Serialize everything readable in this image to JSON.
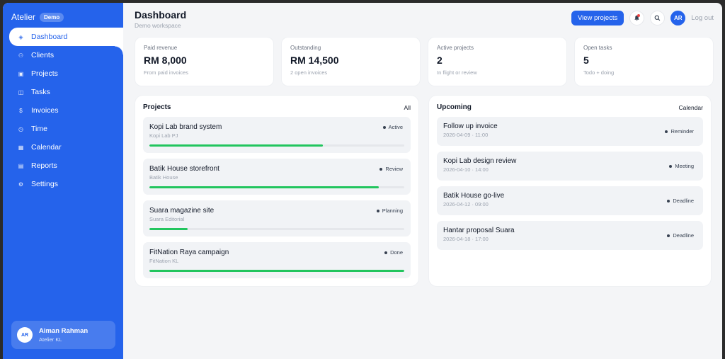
{
  "sidebar": {
    "brand": "Atelier",
    "badge": "Demo",
    "items": [
      {
        "label": "Dashboard",
        "icon": "diamond-icon",
        "glyph": "◈",
        "active": true
      },
      {
        "label": "Clients",
        "icon": "users-icon",
        "glyph": "⚇"
      },
      {
        "label": "Projects",
        "icon": "folder-icon",
        "glyph": "▣"
      },
      {
        "label": "Tasks",
        "icon": "chart-icon",
        "glyph": "◫"
      },
      {
        "label": "Invoices",
        "icon": "dollar-icon",
        "glyph": "$"
      },
      {
        "label": "Time",
        "icon": "clock-icon",
        "glyph": "◷"
      },
      {
        "label": "Calendar",
        "icon": "calendar-icon",
        "glyph": "▦"
      },
      {
        "label": "Reports",
        "icon": "reports-icon",
        "glyph": "▤"
      },
      {
        "label": "Settings",
        "icon": "gear-icon",
        "glyph": "⚙"
      }
    ],
    "user": {
      "initials": "AR",
      "name": "Aiman Rahman",
      "org": "Atelier KL"
    }
  },
  "header": {
    "title": "Dashboard",
    "subtitle": "Demo workspace",
    "view_projects": "View projects",
    "avatar_initials": "AR",
    "logout": "Log out"
  },
  "stats": [
    {
      "label": "Paid revenue",
      "value": "RM 8,000",
      "sub": "From paid invoices"
    },
    {
      "label": "Outstanding",
      "value": "RM 14,500",
      "sub": "2 open invoices"
    },
    {
      "label": "Active projects",
      "value": "2",
      "sub": "In flight or review"
    },
    {
      "label": "Open tasks",
      "value": "5",
      "sub": "Todo + doing"
    }
  ],
  "projects": {
    "title": "Projects",
    "link": "All",
    "items": [
      {
        "name": "Kopi Lab brand system",
        "client": "Kopi Lab PJ",
        "status": "Active",
        "progress": 0.68
      },
      {
        "name": "Batik House storefront",
        "client": "Batik House",
        "status": "Review",
        "progress": 0.9
      },
      {
        "name": "Suara magazine site",
        "client": "Suara Editorial",
        "status": "Planning",
        "progress": 0.15
      },
      {
        "name": "FitNation Raya campaign",
        "client": "FitNation KL",
        "status": "Done",
        "progress": 1.0
      }
    ]
  },
  "upcoming": {
    "title": "Upcoming",
    "link": "Calendar",
    "items": [
      {
        "name": "Follow up invoice",
        "time": "2026-04-09 · 11:00",
        "tag": "Reminder"
      },
      {
        "name": "Kopi Lab design review",
        "time": "2026-04-10 · 14:00",
        "tag": "Meeting"
      },
      {
        "name": "Batik House go-live",
        "time": "2026-04-12 · 09:00",
        "tag": "Deadline"
      },
      {
        "name": "Hantar proposal Suara",
        "time": "2026-04-18 · 17:00",
        "tag": "Deadline"
      }
    ]
  },
  "colors": {
    "accent": "#2563eb",
    "progress": "#22c55e",
    "notification": "#ef4444"
  }
}
